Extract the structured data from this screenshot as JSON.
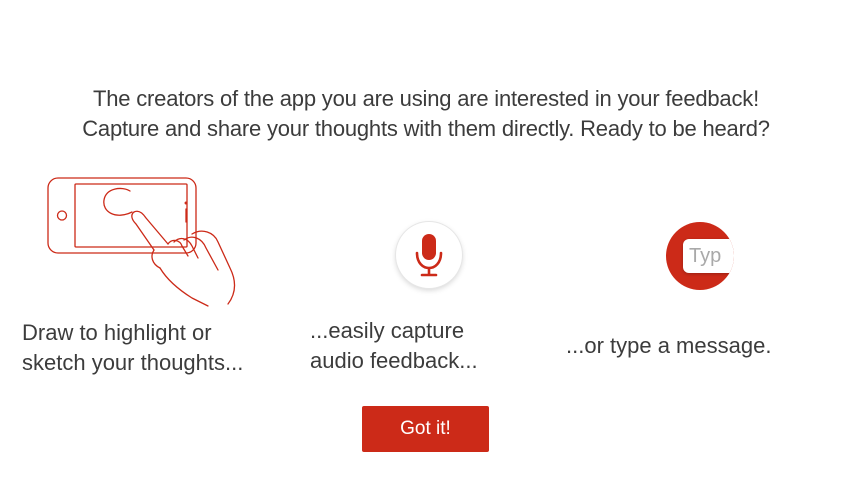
{
  "intro": {
    "line1": "The creators of the app you are using are interested in your feedback!",
    "line2": "Capture and share your thoughts with them directly. Ready to be heard?"
  },
  "features": {
    "draw": {
      "icon": "hand-drawing-on-phone-icon",
      "caption_line1": "Draw to highlight or",
      "caption_line2": "sketch your thoughts..."
    },
    "audio": {
      "icon": "microphone-icon",
      "caption_line1": "...easily capture",
      "caption_line2": "audio feedback..."
    },
    "type": {
      "icon": "text-input-icon",
      "chip_text": "Typ",
      "caption": "...or type a message."
    }
  },
  "actions": {
    "got_it_label": "Got it!"
  },
  "colors": {
    "accent": "#cc2a18",
    "text": "#3c3c3c",
    "placeholder": "#a9a9a9"
  }
}
